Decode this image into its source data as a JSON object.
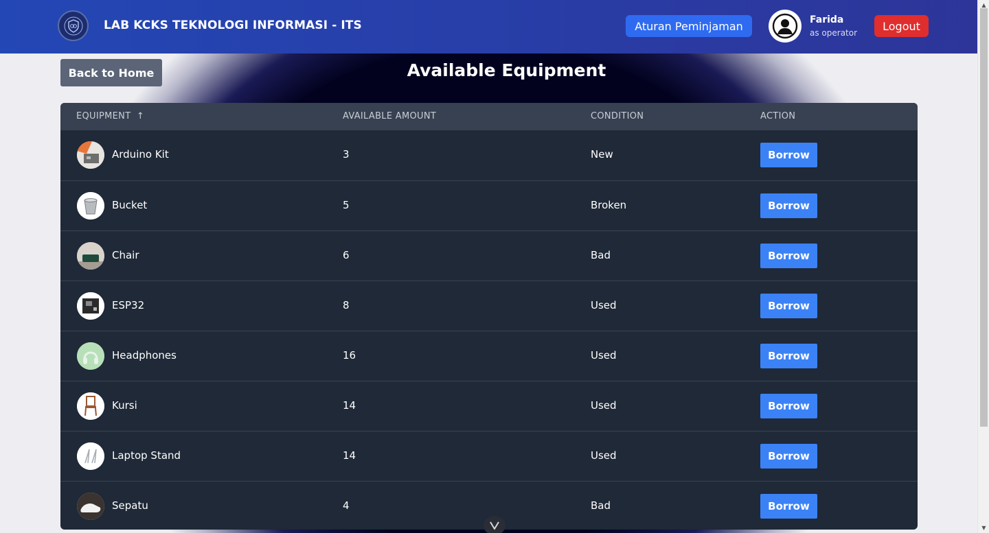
{
  "navbar": {
    "brand": "LAB KCKS TEKNOLOGI INFORMASI - ITS",
    "rules_label": "Aturan Peminjaman",
    "user_name": "Farida",
    "user_role": "as operator",
    "logout_label": "Logout"
  },
  "page": {
    "back_label": "Back to Home",
    "title": "Available Equipment"
  },
  "table": {
    "headers": {
      "equipment": "EQUIPMENT",
      "sort_icon": "↑",
      "amount": "AVAILABLE AMOUNT",
      "condition": "CONDITION",
      "action": "ACTION"
    },
    "rows": [
      {
        "name": "Arduino Kit",
        "amount": "3",
        "condition": "New",
        "action": "Borrow"
      },
      {
        "name": "Bucket",
        "amount": "5",
        "condition": "Broken",
        "action": "Borrow"
      },
      {
        "name": "Chair",
        "amount": "6",
        "condition": "Bad",
        "action": "Borrow"
      },
      {
        "name": "ESP32",
        "amount": "8",
        "condition": "Used",
        "action": "Borrow"
      },
      {
        "name": "Headphones",
        "amount": "16",
        "condition": "Used",
        "action": "Borrow"
      },
      {
        "name": "Kursi",
        "amount": "14",
        "condition": "Used",
        "action": "Borrow"
      },
      {
        "name": "Laptop Stand",
        "amount": "14",
        "condition": "Used",
        "action": "Borrow"
      },
      {
        "name": "Sepatu",
        "amount": "4",
        "condition": "Bad",
        "action": "Borrow"
      }
    ]
  },
  "colors": {
    "accent": "#3b82f6",
    "danger": "#e02d2d",
    "navbar": "#283ea8",
    "table_bg": "#1f2937"
  }
}
